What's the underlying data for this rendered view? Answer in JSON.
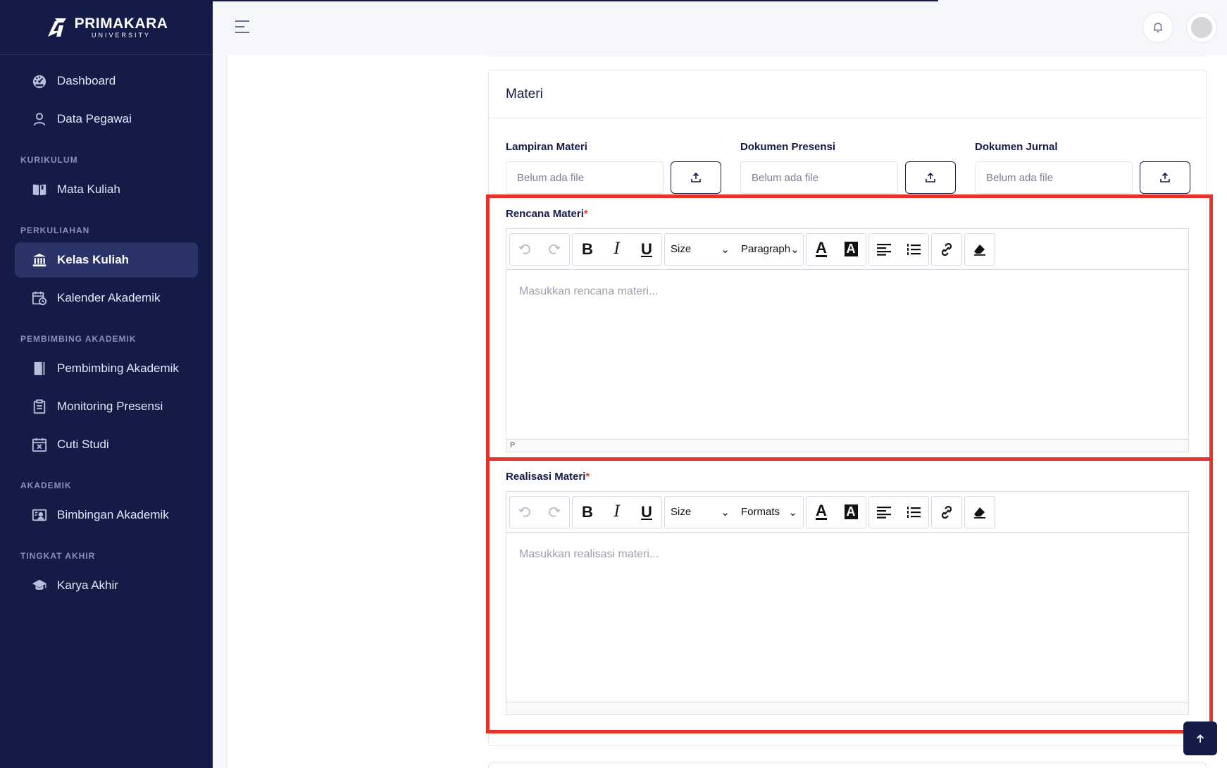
{
  "brand": {
    "name": "PRIMAKARA",
    "sub": "UNIVERSITY"
  },
  "sidebar": {
    "items": [
      {
        "label": "Dashboard",
        "icon": "dashboard-icon"
      },
      {
        "label": "Data Pegawai",
        "icon": "user-icon"
      }
    ],
    "sections": [
      {
        "title": "KURIKULUM",
        "items": [
          {
            "label": "Mata Kuliah",
            "icon": "book-icon"
          }
        ]
      },
      {
        "title": "PERKULIAHAN",
        "items": [
          {
            "label": "Kelas Kuliah",
            "icon": "institution-icon",
            "active": true
          },
          {
            "label": "Kalender Akademik",
            "icon": "calendar-clock-icon"
          }
        ]
      },
      {
        "title": "PEMBIMBING AKADEMIK",
        "items": [
          {
            "label": "Pembimbing Akademik",
            "icon": "notebook-icon"
          },
          {
            "label": "Monitoring Presensi",
            "icon": "clipboard-icon"
          },
          {
            "label": "Cuti Studi",
            "icon": "calendar-x-icon"
          }
        ]
      },
      {
        "title": "AKADEMIK",
        "items": [
          {
            "label": "Bimbingan Akademik",
            "icon": "presentation-icon"
          }
        ]
      },
      {
        "title": "TINGKAT AKHIR",
        "items": [
          {
            "label": "Karya Akhir",
            "icon": "graduation-cap-icon"
          }
        ]
      }
    ]
  },
  "card": {
    "title": "Materi",
    "files": [
      {
        "label": "Lampiran Materi",
        "placeholder": "Belum ada file"
      },
      {
        "label": "Dokumen Presensi",
        "placeholder": "Belum ada file"
      },
      {
        "label": "Dokumen Jurnal",
        "placeholder": "Belum ada file"
      }
    ],
    "editors": [
      {
        "label": "Rencana Materi",
        "required_mark": "*",
        "placeholder": "Masukkan rencana materi...",
        "size_label": "Size",
        "format_label": "Paragraph",
        "status": "P"
      },
      {
        "label": "Realisasi Materi",
        "required_mark": "*",
        "placeholder": "Masukkan realisasi materi...",
        "size_label": "Size",
        "format_label": "Formats",
        "status": ""
      }
    ]
  },
  "colors": {
    "sidebar_bg": "#141b47",
    "highlight": "#e6332a",
    "required": "#e23a3a"
  }
}
